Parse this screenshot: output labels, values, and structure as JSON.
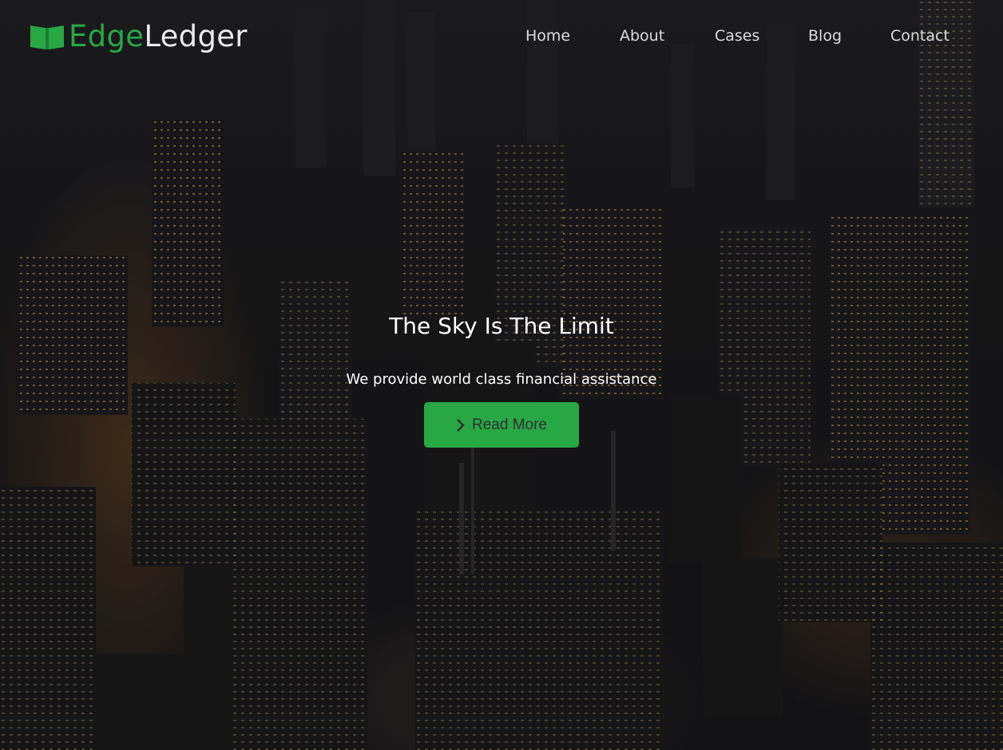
{
  "brand": {
    "part1": "Edge",
    "part2": "Ledger",
    "icon": "open-book-icon",
    "accent_color": "#28a745"
  },
  "nav": {
    "items": [
      {
        "label": "Home"
      },
      {
        "label": "About"
      },
      {
        "label": "Cases"
      },
      {
        "label": "Blog"
      },
      {
        "label": "Contact"
      }
    ]
  },
  "hero": {
    "headline": "The Sky Is The Limit",
    "subline": "We provide world class financial assistance",
    "cta_label": "Read More",
    "cta_icon": "chevron-right-icon",
    "cta_color": "#28a745",
    "background": "night city skyline photo"
  }
}
